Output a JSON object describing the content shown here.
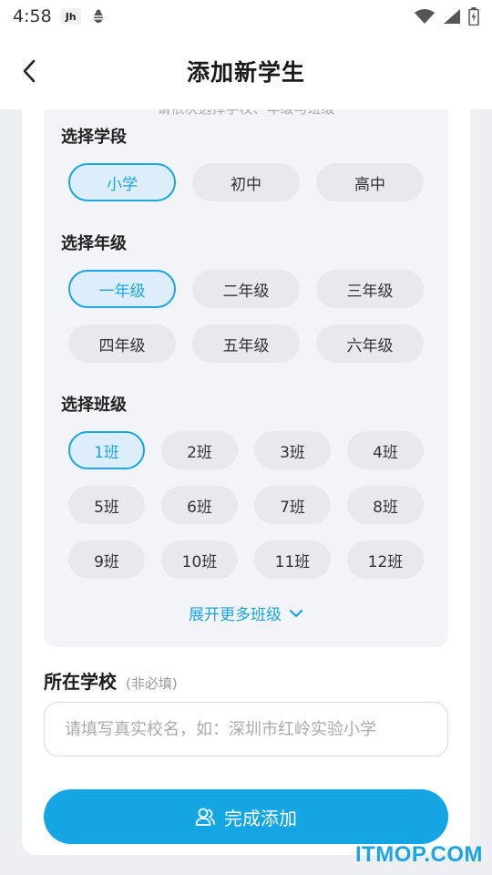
{
  "status": {
    "time": "4:58",
    "app_icon_text": "Jh"
  },
  "nav": {
    "title": "添加新学生"
  },
  "panel": {
    "hint": "请依次选择学校、年级与班级",
    "stage": {
      "label": "选择学段",
      "options": [
        "小学",
        "初中",
        "高中"
      ],
      "selected": "小学"
    },
    "grade": {
      "label": "选择年级",
      "options": [
        "一年级",
        "二年级",
        "三年级",
        "四年级",
        "五年级",
        "六年级"
      ],
      "selected": "一年级"
    },
    "class": {
      "label": "选择班级",
      "options": [
        "1班",
        "2班",
        "3班",
        "4班",
        "5班",
        "6班",
        "7班",
        "8班",
        "9班",
        "10班",
        "11班",
        "12班"
      ],
      "selected": "1班"
    },
    "expand_label": "展开更多班级"
  },
  "school": {
    "title": "所在学校",
    "note": "(非必填)",
    "placeholder": "请填写真实校名，如：深圳市红岭实验小学",
    "value": ""
  },
  "submit_label": "完成添加",
  "watermark": "ITMOP.COM",
  "colors": {
    "accent": "#14a5e3",
    "chip_bg": "#e8e9ed",
    "selected_bg": "#ddedfa",
    "panel_bg": "#f3f4f7",
    "page_bg": "#eeeff2"
  },
  "icons": {
    "back": "chevron-left-icon",
    "expand": "chevron-down-icon",
    "submit": "user-add-icon",
    "wifi": "wifi-icon",
    "signal": "signal-icon",
    "battery": "battery-icon",
    "bug": "bug-icon"
  }
}
